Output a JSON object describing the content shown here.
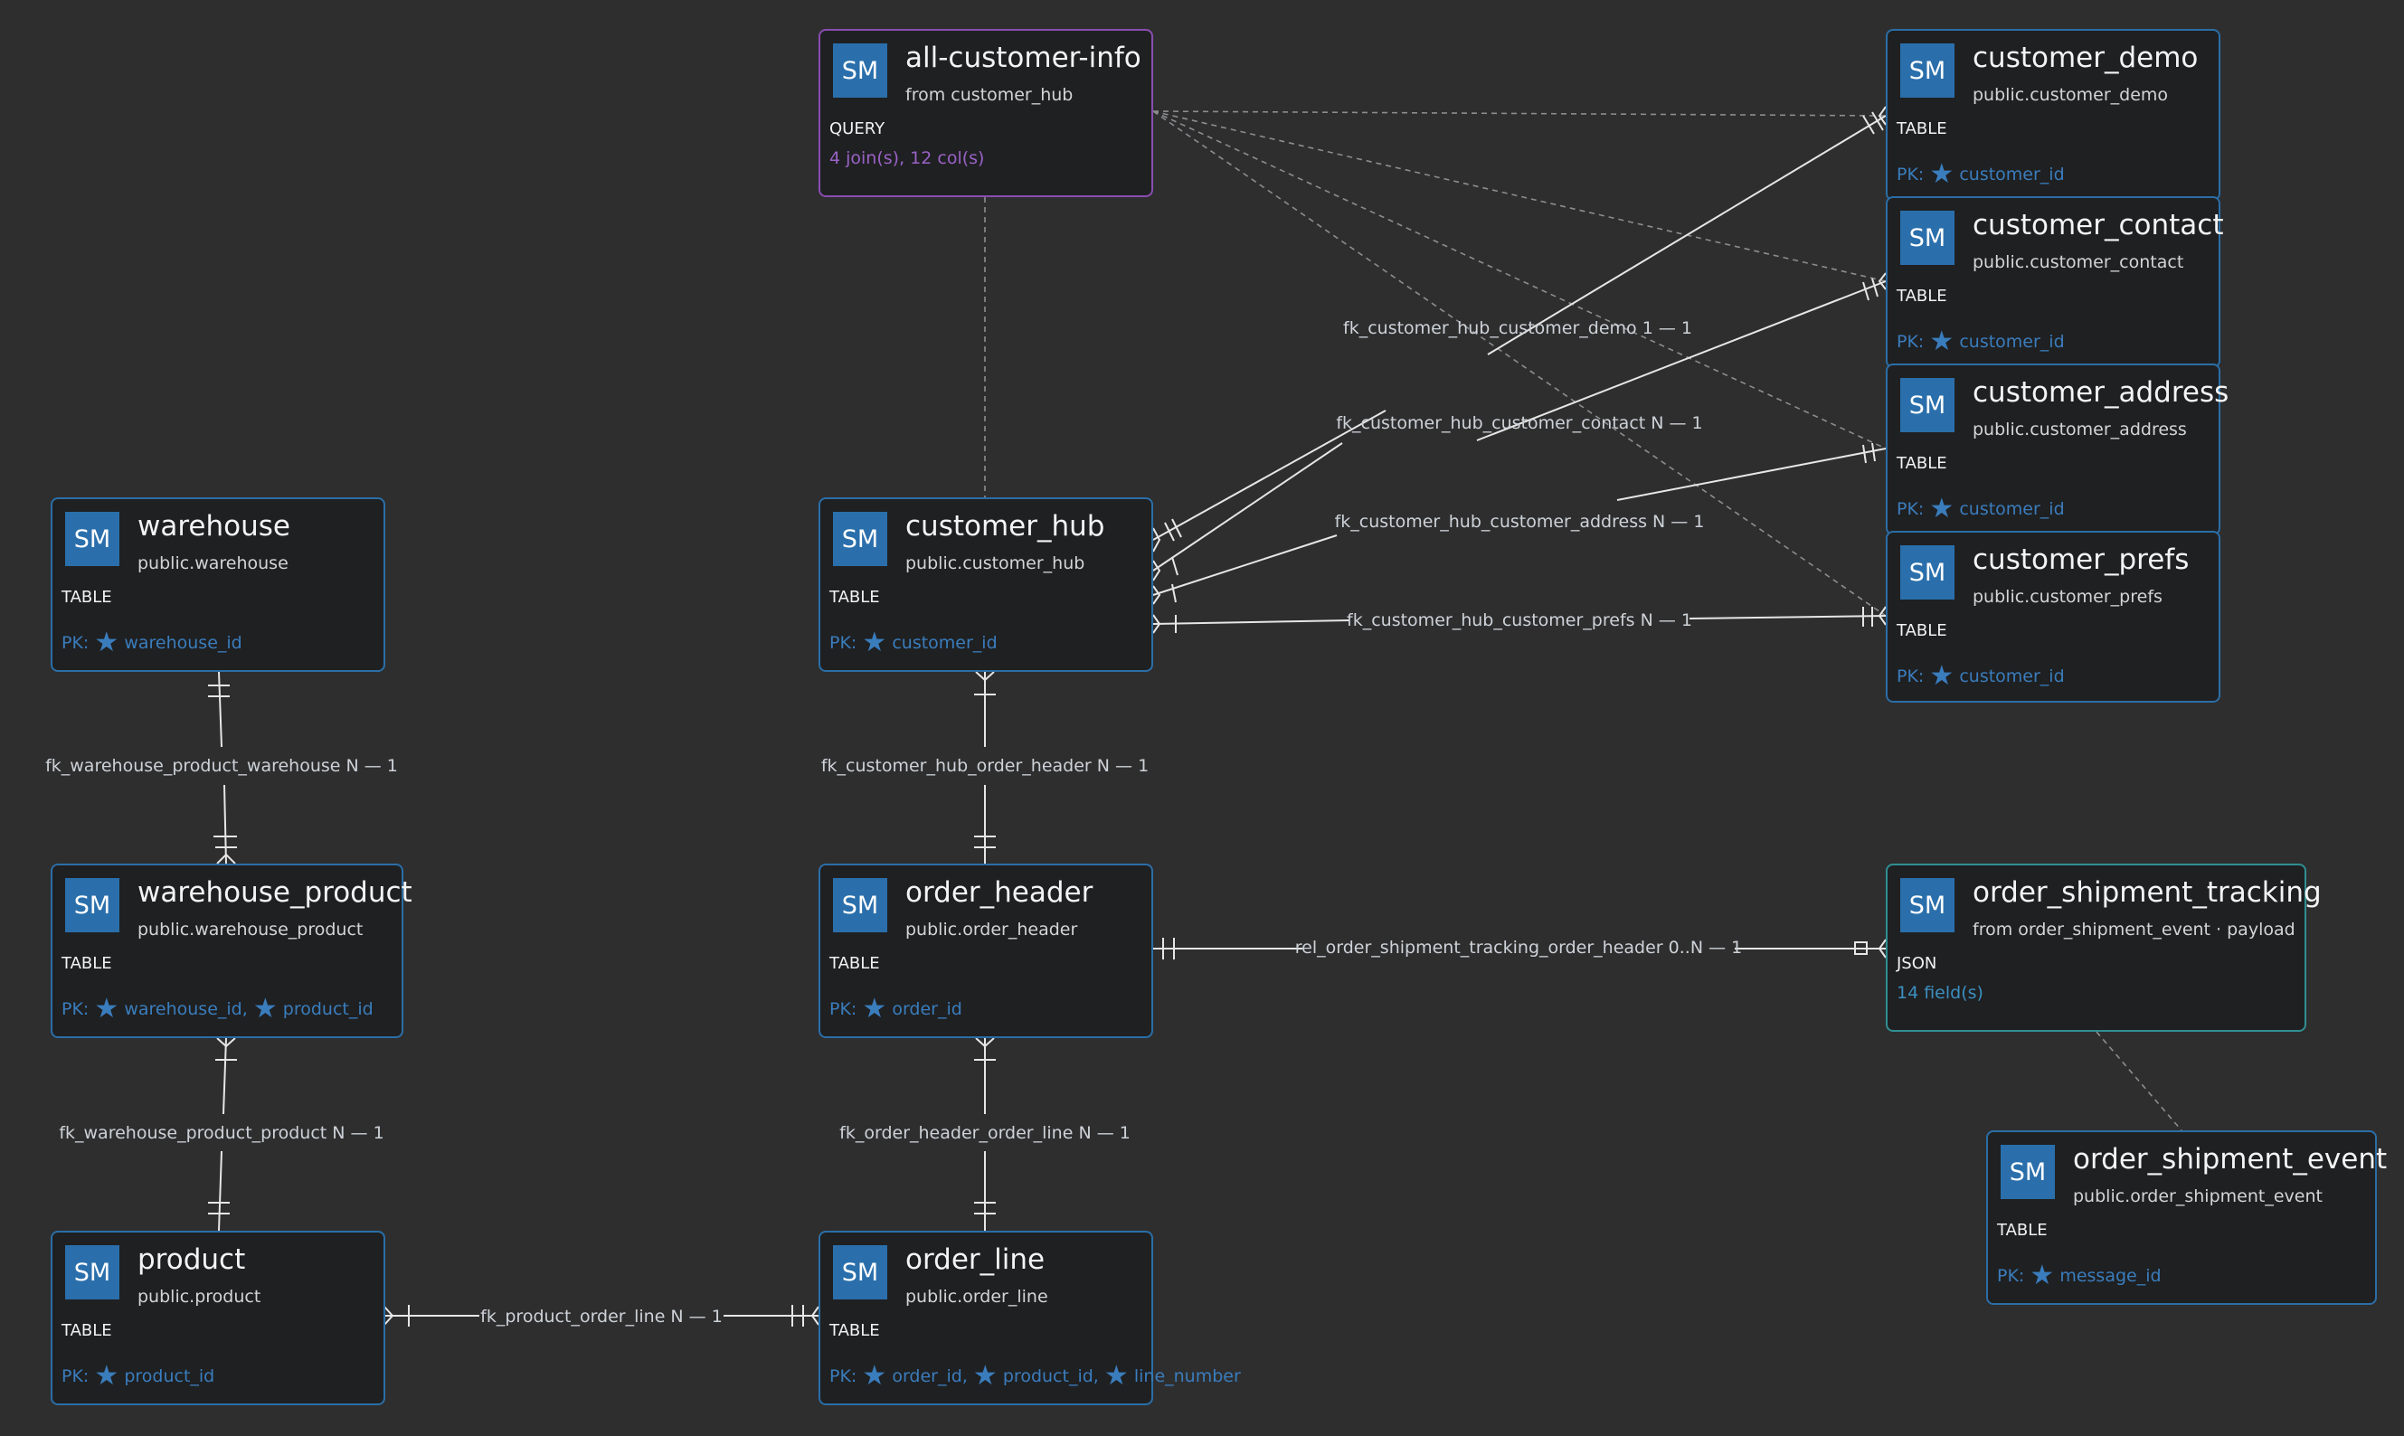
{
  "nodes": {
    "all_customer_info": {
      "badge": "SM",
      "title": "all-customer-info",
      "subtitle": "from customer_hub",
      "kind": "QUERY",
      "detail": "4 join(s), 12 col(s)"
    },
    "customer_demo": {
      "badge": "SM",
      "title": "customer_demo",
      "subtitle": "public.customer_demo",
      "kind": "TABLE",
      "pk_label": "PK:",
      "pk": [
        "customer_id"
      ]
    },
    "customer_contact": {
      "badge": "SM",
      "title": "customer_contact",
      "subtitle": "public.customer_contact",
      "kind": "TABLE",
      "pk_label": "PK:",
      "pk": [
        "customer_id"
      ]
    },
    "customer_address": {
      "badge": "SM",
      "title": "customer_address",
      "subtitle": "public.customer_address",
      "kind": "TABLE",
      "pk_label": "PK:",
      "pk": [
        "customer_id"
      ]
    },
    "customer_prefs": {
      "badge": "SM",
      "title": "customer_prefs",
      "subtitle": "public.customer_prefs",
      "kind": "TABLE",
      "pk_label": "PK:",
      "pk": [
        "customer_id"
      ]
    },
    "warehouse": {
      "badge": "SM",
      "title": "warehouse",
      "subtitle": "public.warehouse",
      "kind": "TABLE",
      "pk_label": "PK:",
      "pk": [
        "warehouse_id"
      ]
    },
    "customer_hub": {
      "badge": "SM",
      "title": "customer_hub",
      "subtitle": "public.customer_hub",
      "kind": "TABLE",
      "pk_label": "PK:",
      "pk": [
        "customer_id"
      ]
    },
    "warehouse_product": {
      "badge": "SM",
      "title": "warehouse_product",
      "subtitle": "public.warehouse_product",
      "kind": "TABLE",
      "pk_label": "PK:",
      "pk": [
        "warehouse_id,",
        "product_id"
      ]
    },
    "order_header": {
      "badge": "SM",
      "title": "order_header",
      "subtitle": "public.order_header",
      "kind": "TABLE",
      "pk_label": "PK:",
      "pk": [
        "order_id"
      ]
    },
    "order_shipment_tracking": {
      "badge": "SM",
      "title": "order_shipment_tracking",
      "subtitle": "from order_shipment_event · payload",
      "kind": "JSON",
      "detail": "14 field(s)"
    },
    "order_shipment_event": {
      "badge": "SM",
      "title": "order_shipment_event",
      "subtitle": "public.order_shipment_event",
      "kind": "TABLE",
      "pk_label": "PK:",
      "pk": [
        "message_id"
      ]
    },
    "product": {
      "badge": "SM",
      "title": "product",
      "subtitle": "public.product",
      "kind": "TABLE",
      "pk_label": "PK:",
      "pk": [
        "product_id"
      ]
    },
    "order_line": {
      "badge": "SM",
      "title": "order_line",
      "subtitle": "public.order_line",
      "kind": "TABLE",
      "pk_label": "PK:",
      "pk": [
        "order_id,",
        "product_id,",
        "line_number"
      ]
    }
  },
  "edges": {
    "fk_customer_hub_customer_demo": "fk_customer_hub_customer_demo  1 — 1",
    "fk_customer_hub_customer_contact": "fk_customer_hub_customer_contact  N — 1",
    "fk_customer_hub_customer_address": "fk_customer_hub_customer_address  N — 1",
    "fk_customer_hub_customer_prefs": "fk_customer_hub_customer_prefs  N — 1",
    "fk_warehouse_product_warehouse": "fk_warehouse_product_warehouse  N — 1",
    "fk_customer_hub_order_header": "fk_customer_hub_order_header  N — 1",
    "rel_order_shipment_tracking_order_header": "rel_order_shipment_tracking_order_header  0..N — 1",
    "fk_warehouse_product_product": "fk_warehouse_product_product  N — 1",
    "fk_order_header_order_line": "fk_order_header_order_line  N — 1",
    "fk_product_order_line": "fk_product_order_line  N — 1"
  }
}
